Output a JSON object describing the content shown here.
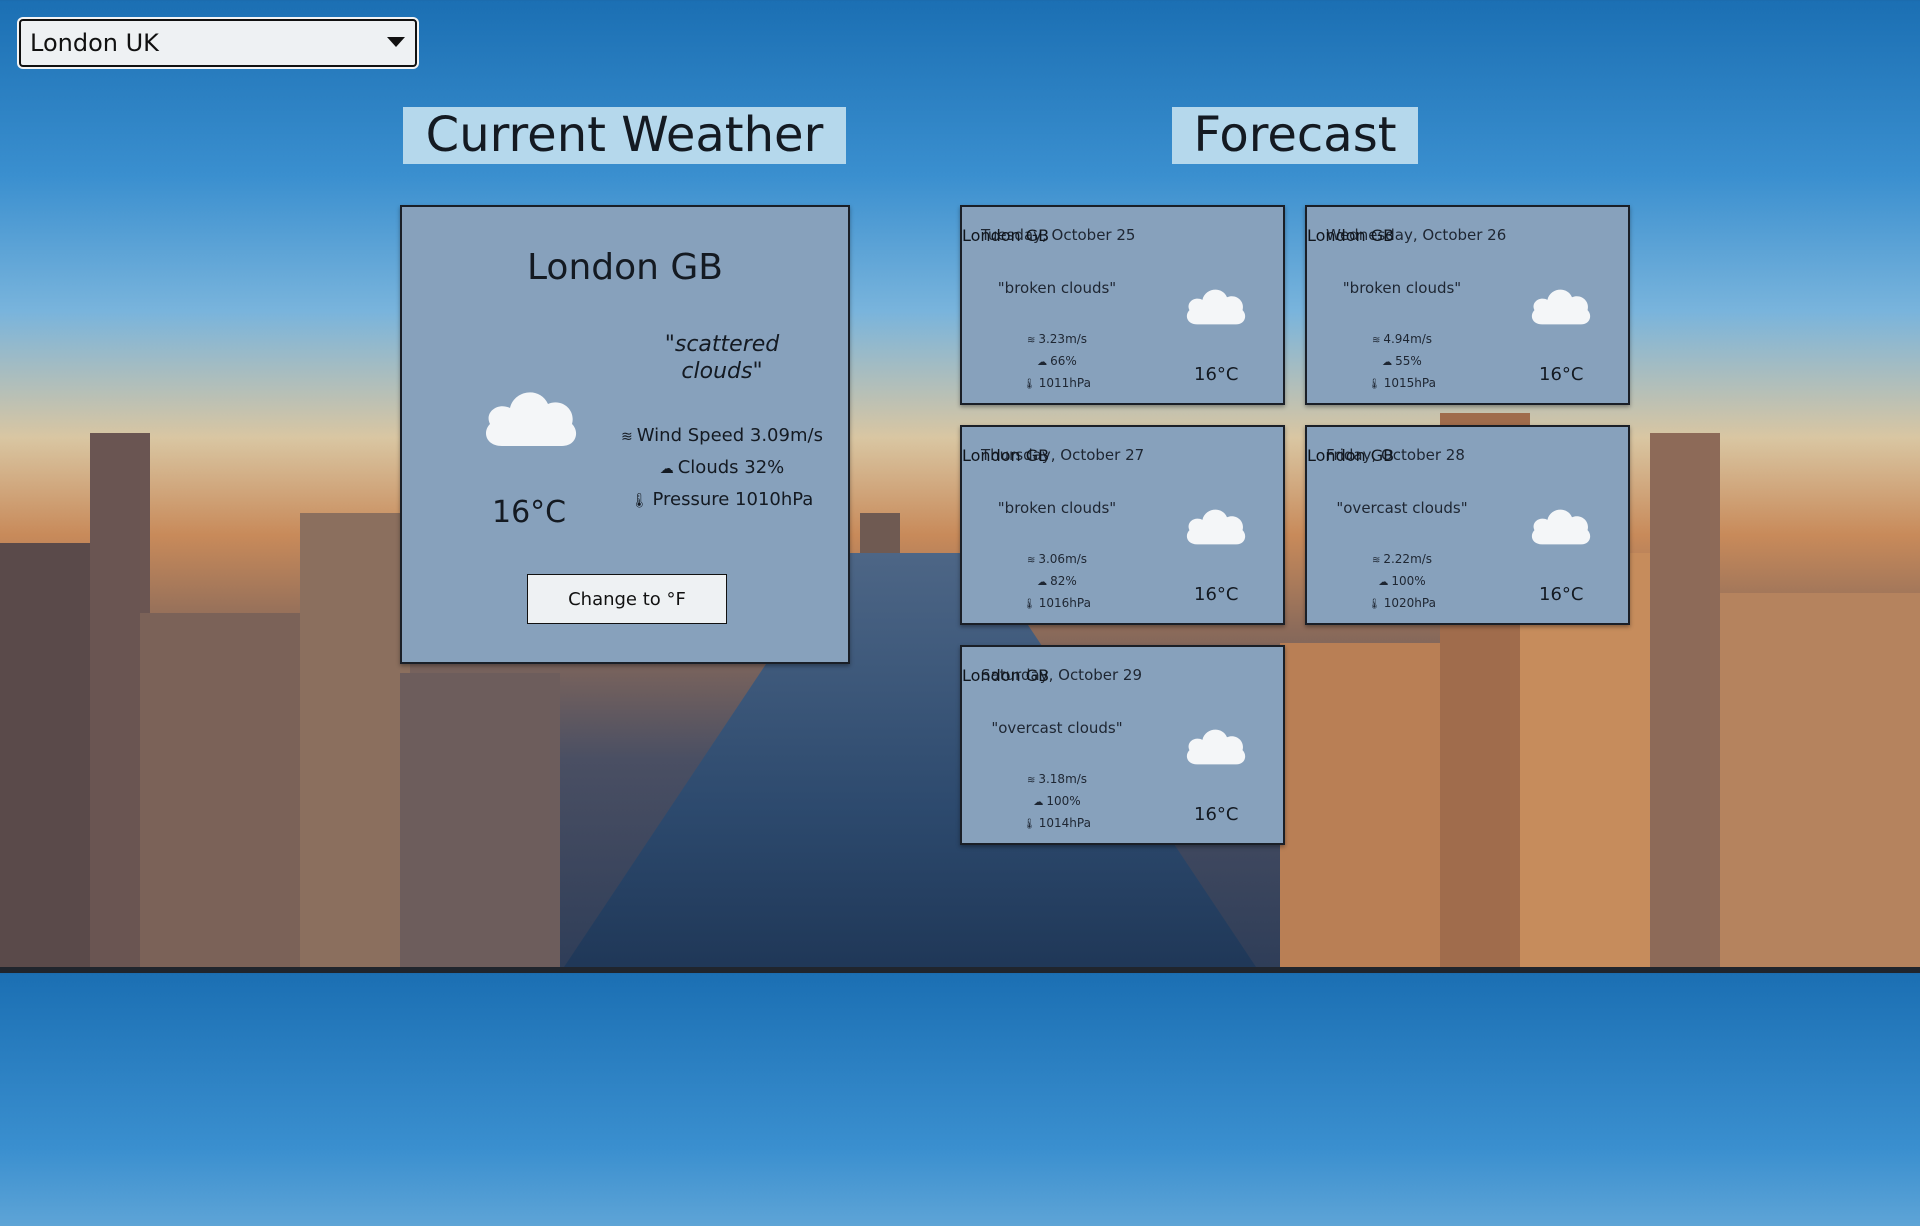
{
  "location_select": {
    "value": "London UK"
  },
  "headings": {
    "current": "Current Weather",
    "forecast": "Forecast"
  },
  "current": {
    "city": "London GB",
    "description": "\"scattered clouds\"",
    "temp": "16°C",
    "wind": "Wind Speed 3.09m/s",
    "clouds": "Clouds 32%",
    "pressure": "Pressure 1010hPa",
    "icon": "cloud-icon",
    "button_label": "Change to °F"
  },
  "forecast": [
    {
      "date": "Tuesday, October 25",
      "city": "London GB",
      "description": "\"broken clouds\"",
      "wind": "3.23m/s",
      "clouds": "66%",
      "pressure": "1011hPa",
      "temp": "16°C",
      "icon": "cloud-icon"
    },
    {
      "date": "Wednesday, October 26",
      "city": "London GB",
      "description": "\"broken clouds\"",
      "wind": "4.94m/s",
      "clouds": "55%",
      "pressure": "1015hPa",
      "temp": "16°C",
      "icon": "cloud-icon"
    },
    {
      "date": "Thursday, October 27",
      "city": "London GB",
      "description": "\"broken clouds\"",
      "wind": "3.06m/s",
      "clouds": "82%",
      "pressure": "1016hPa",
      "temp": "16°C",
      "icon": "cloud-icon"
    },
    {
      "date": "Friday, October 28",
      "city": "London GB",
      "description": "\"overcast clouds\"",
      "wind": "2.22m/s",
      "clouds": "100%",
      "pressure": "1020hPa",
      "temp": "16°C",
      "icon": "cloud-icon"
    },
    {
      "date": "Saturday, October 29",
      "city": "London GB",
      "description": "\"overcast clouds\"",
      "wind": "3.18m/s",
      "clouds": "100%",
      "pressure": "1014hPa",
      "temp": "16°C",
      "icon": "cloud-icon"
    }
  ],
  "colors": {
    "card_bg": "#87a1bc",
    "heading_bg": "#b5d8ec",
    "button_bg": "#eef1f3"
  }
}
